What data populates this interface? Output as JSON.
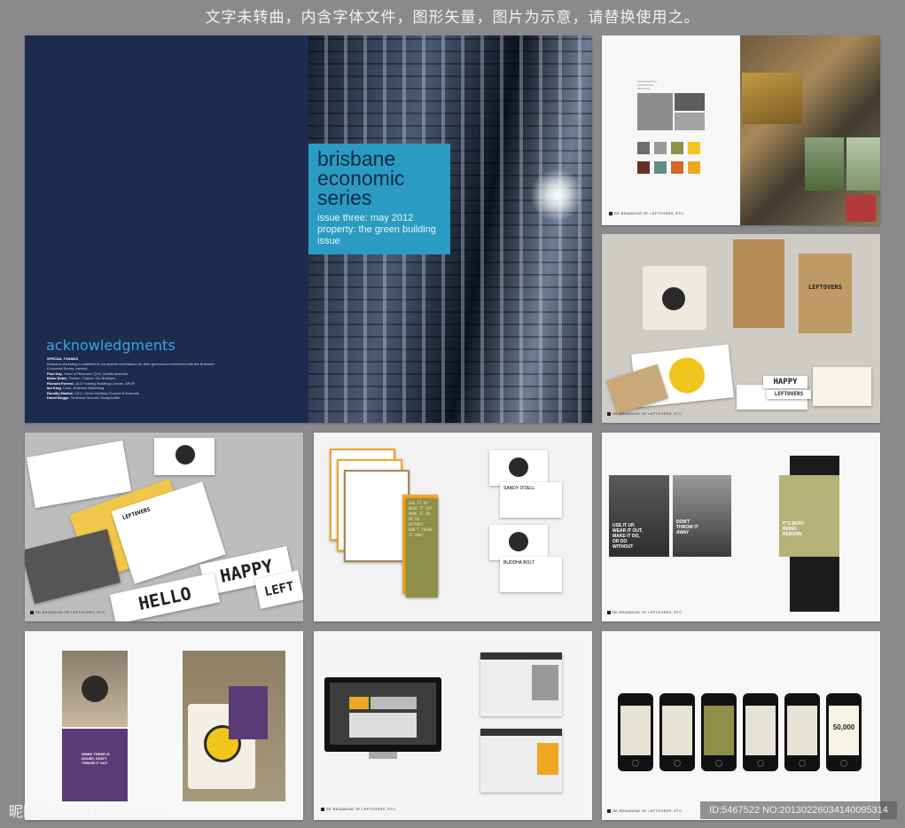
{
  "banner": "文字未转曲，内含字体文件，图形矢量，图片为示意，请替换使用之。",
  "cover": {
    "title": "brisbane economic series",
    "issue": "issue three: may 2012",
    "property": "property: the green building issue",
    "ack_heading": "acknowledgments",
    "special_thanks": "SPECIAL THANKS",
    "intro": "Brisbane Marketing is indebted to our special contributors for their generous involvement with the Brisbane Economic Series, namely:",
    "names": [
      {
        "name": "Paul Day",
        "role": "Head of Research QLD, Savills Australia"
      },
      {
        "name": "Brian Noble",
        "role": "Partner, Clayton Utz Brisbane"
      },
      {
        "name": "Richard Forrest",
        "role": "QLD Existing Buildings Leader, ARUP"
      },
      {
        "name": "Ian Klug",
        "role": "Chair, Brisbane Marketing"
      },
      {
        "name": "Romilly Madew",
        "role": "CEO, Green Building Council of Australia"
      },
      {
        "name": "David Boggs",
        "role": "Technical Director, Ecospecifier"
      }
    ]
  },
  "moodboard": {
    "caption": "RE-BRANDING OF LEFTOVERS, ETC.",
    "swatches": [
      "#6f6e6e",
      "#9a9a9a",
      "#8f8f4a",
      "#f3c51e",
      "#6b2f2a",
      "#5f8f84",
      "#d6662a",
      "#f0a623"
    ]
  },
  "stationery": {
    "caption": "RE-BRANDING OF LEFTOVERS, ETC.",
    "bag_brand": "LEFTOVERS",
    "signs": [
      "HAPPY",
      "LEFTOVERS"
    ]
  },
  "stationery2": {
    "caption": "RE-BRANDING OF LEFTOVERS, ETC.",
    "brand": "LEFTOVERS",
    "signs": [
      "HAPPY",
      "HELLO",
      "LEFT"
    ]
  },
  "letterhead": {
    "card_names": [
      "SANDY O'DELL",
      "BUDDHA BOLT"
    ],
    "menu_lines": [
      "USE IT UP",
      "WEAR IT OUT",
      "MAKE IT DO",
      "OR DO WITHOUT",
      "DON'T THROW IT AWAY"
    ]
  },
  "posters": {
    "caption": "RE-BRANDING OF LEFTOVERS, ETC.",
    "poster1": "USE IT UP, WEAR IT OUT, MAKE IT DO, OR DO WITHOUT",
    "poster2": "DON'T THROW IT AWAY",
    "poster3": "IT'S BUSY BEING REBORN"
  },
  "shirts": {
    "shirt_text": "WHEN THERE IS DOUBT, DON'T THROW IT OUT"
  },
  "web": {
    "caption": "RE-BRANDING OF LEFTOVERS, ETC."
  },
  "phones": {
    "caption": "RE-BRANDING OF LEFTOVERS, ETC.",
    "last_screen_number": "50,000"
  },
  "watermark_left": "昵图网 www.nipic.com",
  "watermark_right": "ID:5467522 NO:20130226034140095314"
}
